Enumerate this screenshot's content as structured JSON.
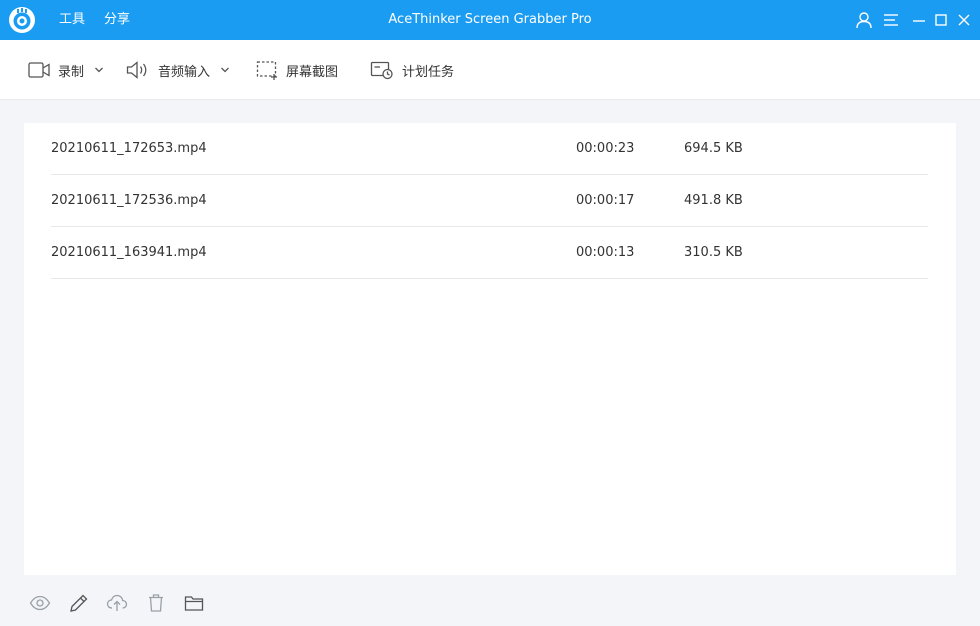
{
  "app": {
    "title": "AceThinker Screen Grabber Pro"
  },
  "menu": {
    "tools": "工具",
    "share": "分享"
  },
  "toolbar": {
    "record": "录制",
    "audio_input": "音频输入",
    "screenshot": "屏幕截图",
    "schedule": "计划任务"
  },
  "files": [
    {
      "name": "20210611_172653.mp4",
      "duration": "00:00:23",
      "size": "694.5 KB"
    },
    {
      "name": "20210611_172536.mp4",
      "duration": "00:00:17",
      "size": "491.8 KB"
    },
    {
      "name": "20210611_163941.mp4",
      "duration": "00:00:13",
      "size": "310.5 KB"
    }
  ],
  "colors": {
    "accent": "#1a9cf3",
    "icon_gray": "#8a8f99"
  },
  "bottom_actions": [
    "eye-icon",
    "pencil-icon",
    "cloud-upload-icon",
    "trash-icon",
    "folder-icon"
  ]
}
